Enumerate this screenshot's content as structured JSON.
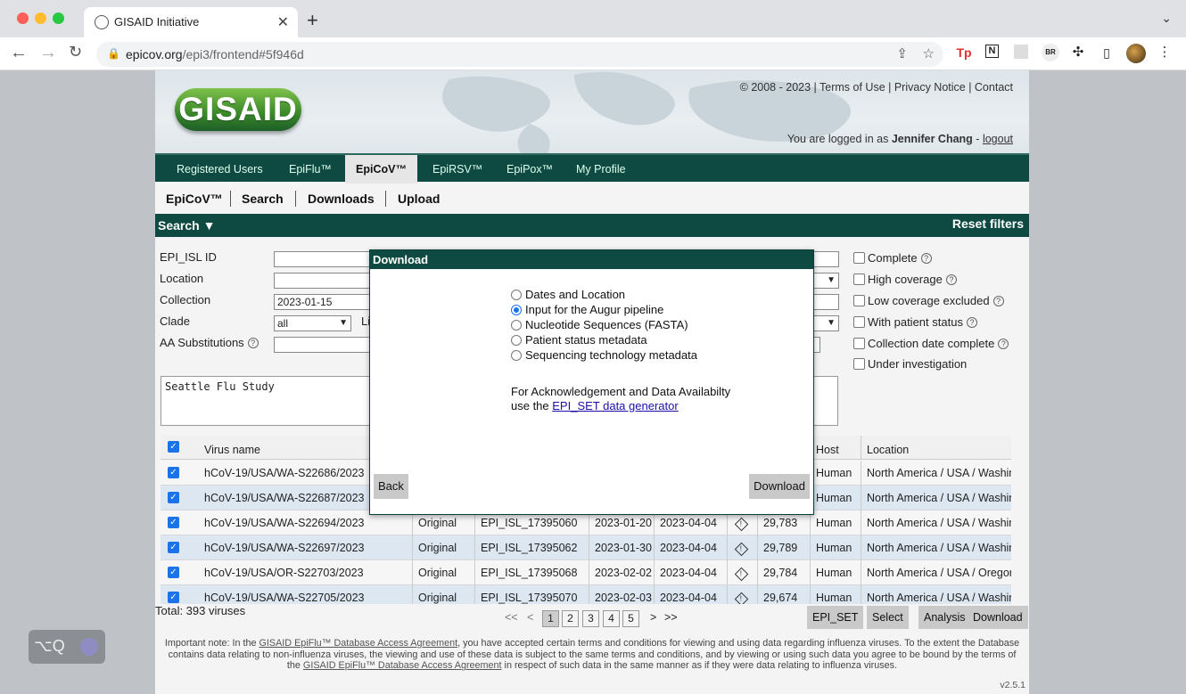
{
  "browser": {
    "tab_title": "GISAID Initiative",
    "url_host": "epicov.org",
    "url_path": "/epi3/frontend#5f946d",
    "new_tab": "+",
    "close_tab": "✕"
  },
  "header": {
    "logo": "GISAID",
    "copyright": "© 2008 - 2023 | Terms of Use | Privacy Notice | Contact",
    "logged_prefix": "You are logged in as",
    "user": "Jennifer Chang",
    "logout": "logout"
  },
  "nav": [
    "Registered Users",
    "EpiFlu™",
    "EpiCoV™",
    "EpiRSV™",
    "EpiPox™",
    "My Profile"
  ],
  "subnav": [
    "EpiCoV™",
    "Search",
    "Downloads",
    "Upload"
  ],
  "search": {
    "title": "Search ▼",
    "reset": "Reset filters",
    "labels": {
      "epi": "EPI_ISL ID",
      "location": "Location",
      "collection": "Collection",
      "clade": "Clade",
      "aa": "AA Substitutions",
      "li": "Li"
    },
    "collection_value": "2023-01-15",
    "clade_value": "all",
    "query": "Seattle Flu Study",
    "checks": [
      "Complete",
      "High coverage",
      "Low coverage excluded",
      "With patient status",
      "Collection date complete",
      "Under investigation"
    ]
  },
  "table": {
    "headers": {
      "virus": "Virus name",
      "host": "Host",
      "location": "Location"
    },
    "rows": [
      {
        "name": "hCoV-19/USA/WA-S22686/2023",
        "passage": "",
        "id": "",
        "coll": "",
        "sub": "",
        "len": "",
        "host": "Human",
        "loc": "North America / USA / Washin"
      },
      {
        "name": "hCoV-19/USA/WA-S22687/2023",
        "passage": "",
        "id": "",
        "coll": "",
        "sub": "",
        "len": "",
        "host": "Human",
        "loc": "North America / USA / Washin"
      },
      {
        "name": "hCoV-19/USA/WA-S22694/2023",
        "passage": "Original",
        "id": "EPI_ISL_17395060",
        "coll": "2023-01-20",
        "sub": "2023-04-04",
        "len": "29,783",
        "host": "Human",
        "loc": "North America / USA / Washin"
      },
      {
        "name": "hCoV-19/USA/WA-S22697/2023",
        "passage": "Original",
        "id": "EPI_ISL_17395062",
        "coll": "2023-01-30",
        "sub": "2023-04-04",
        "len": "29,789",
        "host": "Human",
        "loc": "North America / USA / Washin"
      },
      {
        "name": "hCoV-19/USA/OR-S22703/2023",
        "passage": "Original",
        "id": "EPI_ISL_17395068",
        "coll": "2023-02-02",
        "sub": "2023-04-04",
        "len": "29,784",
        "host": "Human",
        "loc": "North America / USA / Oregor"
      },
      {
        "name": "hCoV-19/USA/WA-S22705/2023",
        "passage": "Original",
        "id": "EPI_ISL_17395070",
        "coll": "2023-02-03",
        "sub": "2023-04-04",
        "len": "29,674",
        "host": "Human",
        "loc": "North America / USA / Washin"
      }
    ],
    "total": "Total: 393 viruses"
  },
  "pager": {
    "first": "<<",
    "prev": "<",
    "pages": [
      "1",
      "2",
      "3",
      "4",
      "5"
    ],
    "next": ">",
    "last": ">>"
  },
  "actions": [
    "EPI_SET",
    "Select",
    "Analysis",
    "Download"
  ],
  "note": {
    "p1": "Important note: In the ",
    "link1": "GISAID EpiFlu™ Database Access Agreement",
    "p2": ", you have accepted certain terms and conditions for viewing and using data regarding influenza viruses. To the extent the Database contains data relating to non-influenza viruses, the viewing and use of these data is subject to the same terms and conditions, and by viewing or using such data you agree to be bound by the terms of the ",
    "link2": "GISAID EpiFlu™ Database Access Agreement",
    "p3": " in respect of such data in the same manner as if they were data relating to influenza viruses."
  },
  "version": "v2.5.1",
  "dialog": {
    "title": "Download",
    "options": [
      "Dates and Location",
      "Input for the Augur pipeline",
      "Nucleotide Sequences (FASTA)",
      "Patient status metadata",
      "Sequencing technology metadata"
    ],
    "selected_index": 1,
    "ack_line1": "For Acknowledgement and Data Availabilty",
    "ack_line2": "use the ",
    "ack_link": "EPI_SET data generator",
    "back": "Back",
    "download": "Download"
  },
  "widget": {
    "keys": "⌥Q"
  }
}
